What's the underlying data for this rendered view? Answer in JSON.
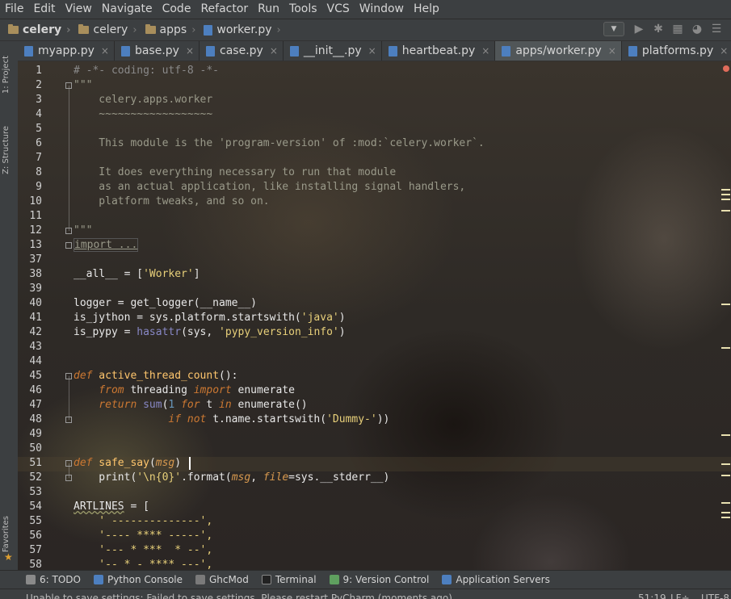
{
  "menu": [
    "File",
    "Edit",
    "View",
    "Navigate",
    "Code",
    "Refactor",
    "Run",
    "Tools",
    "VCS",
    "Window",
    "Help"
  ],
  "breadcrumb": [
    "celery",
    "celery",
    "apps",
    "worker.py"
  ],
  "tabs": [
    {
      "label": "myapp.py",
      "active": false
    },
    {
      "label": "base.py",
      "active": false
    },
    {
      "label": "case.py",
      "active": false
    },
    {
      "label": "__init__.py",
      "active": false
    },
    {
      "label": "heartbeat.py",
      "active": false
    },
    {
      "label": "apps/worker.py",
      "active": true
    },
    {
      "label": "platforms.py",
      "active": false
    }
  ],
  "left_tools": {
    "project": "1: Project",
    "structure": "Z: Structure",
    "favorites": "Favorites"
  },
  "line_numbers": [
    "1",
    "2",
    "3",
    "4",
    "5",
    "6",
    "7",
    "8",
    "9",
    "10",
    "11",
    "12",
    "13",
    "37",
    "38",
    "39",
    "40",
    "41",
    "42",
    "43",
    "44",
    "45",
    "46",
    "47",
    "48",
    "49",
    "50",
    "51",
    "52",
    "53",
    "54",
    "55",
    "56",
    "57",
    "58"
  ],
  "code": {
    "l1": "# -*- coding: utf-8 -*-",
    "l2": "\"\"\"",
    "l3": "    celery.apps.worker",
    "l4": "    ~~~~~~~~~~~~~~~~~~",
    "l6": "    This module is the 'program-version' of :mod:`celery.worker`.",
    "l8": "    It does everything necessary to run that module",
    "l9": "    as an actual application, like installing signal handlers,",
    "l10": "    platform tweaks, and so on.",
    "l12": "\"\"\"",
    "l13": "import ...",
    "l38a": "__all__ = [",
    "l38b": "'Worker'",
    "l38c": "]",
    "l40": "logger = get_logger(__name__)",
    "l41a": "is_jython = sys.platform.startswith(",
    "l41b": "'java'",
    "l41c": ")",
    "l42a": "is_pypy = ",
    "l42b": "hasattr",
    "l42c": "(sys, ",
    "l42d": "'pypy_version_info'",
    "l42e": ")",
    "l45a": "def",
    "l45b": " active_thread_count",
    "l45c": "():",
    "l46a": "    from",
    "l46b": " threading ",
    "l46c": "import",
    "l46d": " enumerate",
    "l47a": "    return",
    "l47b": " sum",
    "l47c": "(",
    "l47d": "1",
    "l47e": " for",
    "l47f": " t ",
    "l47g": "in",
    "l47h": " enumerate()",
    "l48a": "               if not",
    "l48b": " t.name.startswith(",
    "l48c": "'Dummy-'",
    "l48d": "))",
    "l51a": "def",
    "l51b": " safe_say",
    "l51c": "(",
    "l51d": "msg",
    "l51e": ")",
    "l52a": "    print(",
    "l52b": "'\\n{0}'",
    "l52c": ".format(",
    "l52d": "msg",
    "l52e": ", ",
    "l52f": "file",
    "l52g": "=sys.__stderr__)",
    "l54a": "ARTLINES",
    "l54b": " = [",
    "l55": "    ' --------------',",
    "l56": "    '---- **** -----',",
    "l57": "    '--- * ***  * --',",
    "l58": "    '-- * - **** ---',"
  },
  "tool_windows": [
    {
      "label": "6: TODO",
      "icon": "todo-icon"
    },
    {
      "label": "Python Console",
      "icon": "python-console-icon"
    },
    {
      "label": "GhcMod",
      "icon": "ghcmod-icon"
    },
    {
      "label": "Terminal",
      "icon": "terminal-icon"
    },
    {
      "label": "9: Version Control",
      "icon": "version-control-icon"
    },
    {
      "label": "Application Servers",
      "icon": "application-servers-icon"
    }
  ],
  "status": {
    "message": "Unable to save settings: Failed to save settings. Please restart PyCharm (moments ago)",
    "position": "51:19",
    "line_sep": "LF÷",
    "encoding": "UTF-8"
  },
  "colors": {
    "accent": "#cc7832",
    "string": "#e8d07a",
    "function": "#ffc66d",
    "builtin": "#8888c6",
    "error": "#e06c5b"
  }
}
